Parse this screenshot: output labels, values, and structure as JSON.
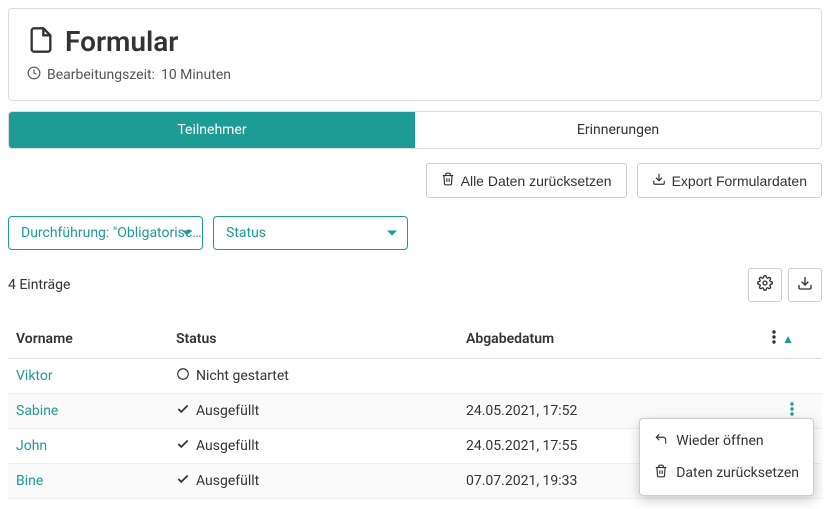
{
  "header": {
    "title": "Formular",
    "subtitle_prefix": "Bearbeitungszeit:",
    "subtitle_value": "10 Minuten"
  },
  "tabs": {
    "participants": "Teilnehmer",
    "reminders": "Erinnerungen"
  },
  "actions": {
    "reset_all": "Alle Daten zurücksetzen",
    "export": "Export Formulardaten"
  },
  "filters": {
    "execution_label": "Durchführung:",
    "execution_value": "\"Obligatorisc…",
    "status_label": "Status"
  },
  "count_text": "4 Einträge",
  "columns": {
    "firstname": "Vorname",
    "status": "Status",
    "submitted": "Abgabedatum"
  },
  "status_labels": {
    "not_started": "Nicht gestartet",
    "filled": "Ausgefüllt"
  },
  "rows": [
    {
      "name": "Viktor",
      "status": "not_started",
      "date": ""
    },
    {
      "name": "Sabine",
      "status": "filled",
      "date": "24.05.2021, 17:52"
    },
    {
      "name": "John",
      "status": "filled",
      "date": "24.05.2021, 17:55"
    },
    {
      "name": "Bine",
      "status": "filled",
      "date": "07.07.2021, 19:33"
    }
  ],
  "popup": {
    "reopen": "Wieder öffnen",
    "reset": "Daten zurücksetzen"
  }
}
